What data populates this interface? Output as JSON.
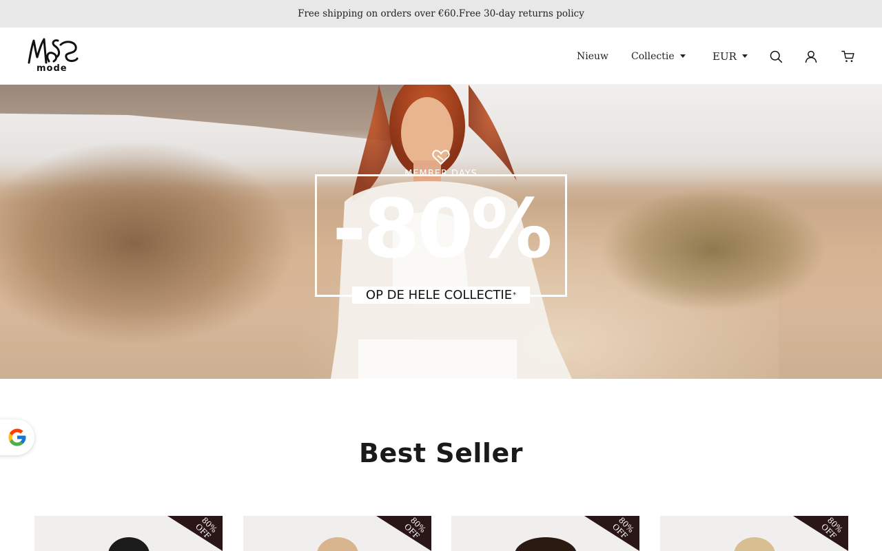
{
  "announcement": "Free shipping on orders over €60.Free 30-day returns policy",
  "brand": {
    "logo_text": "ms",
    "logo_subtext": "mode"
  },
  "nav": {
    "new": "Nieuw",
    "collection": "Collectie",
    "currency": "EUR"
  },
  "icons": {
    "search": "search-icon",
    "account": "user-icon",
    "cart": "cart-icon",
    "google": "google-icon"
  },
  "hero": {
    "kicker": "MEMBER DAYS",
    "discount": "-80%",
    "subline": "OP DE HELE COLLECTIE",
    "subline_mark": "*"
  },
  "section": {
    "title": "Best Seller"
  },
  "products": [
    {
      "badge_pct": "80%",
      "badge_off": "OFF"
    },
    {
      "badge_pct": "80%",
      "badge_off": "OFF"
    },
    {
      "badge_pct": "80%",
      "badge_off": "OFF"
    },
    {
      "badge_pct": "80%",
      "badge_off": "OFF"
    }
  ],
  "colors": {
    "announcement_bg": "#e8e8e8",
    "badge_bg": "#2a1517",
    "text": "#222222"
  }
}
